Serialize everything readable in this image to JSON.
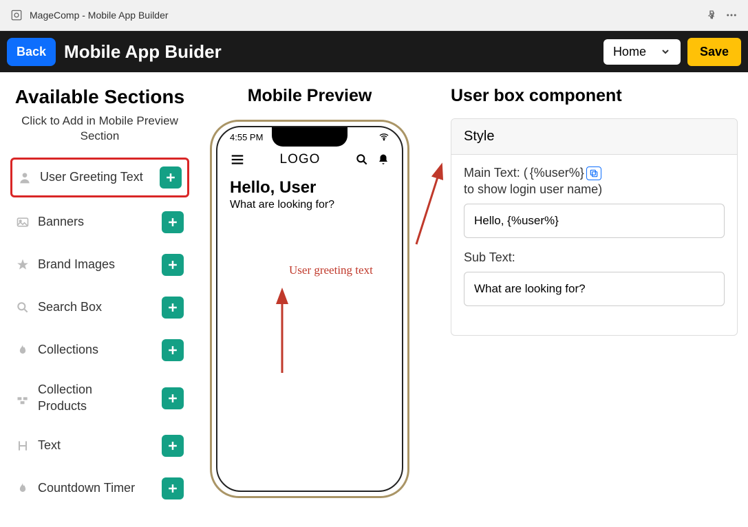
{
  "window": {
    "title": "MageComp - Mobile App Builder"
  },
  "nav": {
    "back_label": "Back",
    "title": "Mobile App Buider",
    "home_label": "Home",
    "save_label": "Save"
  },
  "sidebar": {
    "title": "Available Sections",
    "subtitle": "Click to Add in Mobile Preview Section",
    "items": [
      {
        "label": "User Greeting Text",
        "icon": "user"
      },
      {
        "label": "Banners",
        "icon": "image"
      },
      {
        "label": "Brand Images",
        "icon": "star"
      },
      {
        "label": "Search Box",
        "icon": "search"
      },
      {
        "label": "Collections",
        "icon": "flame"
      },
      {
        "label": "Collection Products",
        "icon": "grid"
      },
      {
        "label": "Text",
        "icon": "heading"
      },
      {
        "label": "Countdown Timer",
        "icon": "flame"
      }
    ]
  },
  "preview": {
    "title": "Mobile Preview",
    "time": "4:55 PM",
    "logo": "LOGO",
    "greeting_main": "Hello, User",
    "greeting_sub": "What are looking for?"
  },
  "panel": {
    "title": "User box component",
    "style_label": "Style",
    "main_text_label_prefix": "Main Text: (",
    "main_text_placeholder_chip": "{%user%}",
    "main_text_label_suffix": " to show login user name)",
    "main_text_value": "Hello, {%user%}",
    "sub_text_label": "Sub Text:",
    "sub_text_value": "What are looking for?"
  },
  "annotations": {
    "greeting": "User greeting text"
  }
}
